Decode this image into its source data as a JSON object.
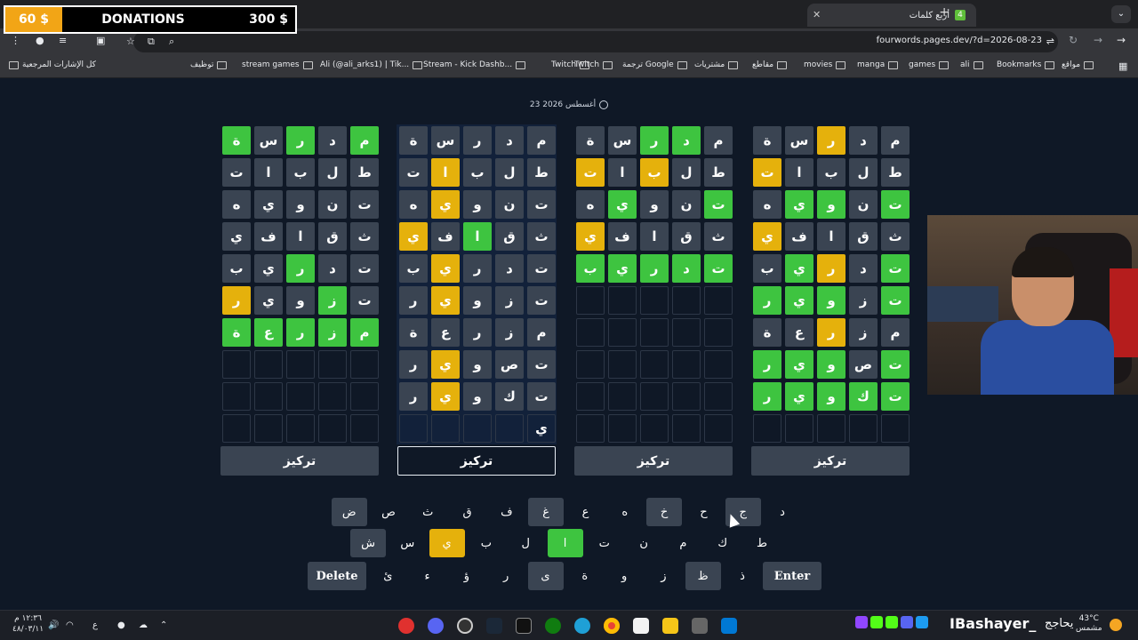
{
  "browser": {
    "tab_title": "أربع كلمات",
    "url": "fourwords.pages.dev/?d=2026-08-23",
    "bookmarks": [
      "مواقع",
      "Bookmarks",
      "ali",
      "games",
      "manga",
      "movies",
      "مقاطع",
      "مشتريات",
      "ترجمة Google",
      "Twitch",
      "Twitch",
      "Stream - Kick Dashb...",
      "Ali (@ali_arks1) | Tik...",
      "stream games",
      "توظيف"
    ],
    "bookmarks_right_label": "كل الإشارات المرجعية"
  },
  "donations": {
    "current": "60 $",
    "label": "DONATIONS",
    "goal": "300 $"
  },
  "date_label": "23 أغسطس 2026",
  "focus_label": "تركيز",
  "boards": [
    {
      "rows": [
        [
          [
            "م",
            "g"
          ],
          [
            "د",
            "n"
          ],
          [
            "ر",
            "g"
          ],
          [
            "س",
            "n"
          ],
          [
            "ة",
            "g"
          ]
        ],
        [
          [
            "ط",
            "n"
          ],
          [
            "ل",
            "n"
          ],
          [
            "ب",
            "n"
          ],
          [
            "ا",
            "n"
          ],
          [
            "ت",
            "n"
          ]
        ],
        [
          [
            "ت",
            "n"
          ],
          [
            "ن",
            "n"
          ],
          [
            "و",
            "n"
          ],
          [
            "ي",
            "n"
          ],
          [
            "ه",
            "n"
          ]
        ],
        [
          [
            "ث",
            "n"
          ],
          [
            "ق",
            "n"
          ],
          [
            "ا",
            "n"
          ],
          [
            "ف",
            "n"
          ],
          [
            "ي",
            "n"
          ]
        ],
        [
          [
            "ت",
            "n"
          ],
          [
            "د",
            "n"
          ],
          [
            "ر",
            "g"
          ],
          [
            "ي",
            "n"
          ],
          [
            "ب",
            "n"
          ]
        ],
        [
          [
            "ت",
            "n"
          ],
          [
            "ز",
            "g"
          ],
          [
            "و",
            "n"
          ],
          [
            "ي",
            "n"
          ],
          [
            "ر",
            "y"
          ]
        ],
        [
          [
            "م",
            "g"
          ],
          [
            "ز",
            "g"
          ],
          [
            "ر",
            "g"
          ],
          [
            "ع",
            "g"
          ],
          [
            "ة",
            "g"
          ]
        ],
        [
          [
            "",
            "e"
          ],
          [
            "",
            "e"
          ],
          [
            "",
            "e"
          ],
          [
            "",
            "e"
          ],
          [
            "",
            "e"
          ]
        ],
        [
          [
            "",
            "e"
          ],
          [
            "",
            "e"
          ],
          [
            "",
            "e"
          ],
          [
            "",
            "e"
          ],
          [
            "",
            "e"
          ]
        ],
        [
          [
            "",
            "e"
          ],
          [
            "",
            "e"
          ],
          [
            "",
            "e"
          ],
          [
            "",
            "e"
          ],
          [
            "",
            "e"
          ]
        ]
      ]
    },
    {
      "rows": [
        [
          [
            "م",
            "n"
          ],
          [
            "د",
            "n"
          ],
          [
            "ر",
            "n"
          ],
          [
            "س",
            "n"
          ],
          [
            "ة",
            "n"
          ]
        ],
        [
          [
            "ط",
            "n"
          ],
          [
            "ل",
            "n"
          ],
          [
            "ب",
            "n"
          ],
          [
            "ا",
            "y"
          ],
          [
            "ت",
            "n"
          ]
        ],
        [
          [
            "ت",
            "n"
          ],
          [
            "ن",
            "n"
          ],
          [
            "و",
            "n"
          ],
          [
            "ي",
            "y"
          ],
          [
            "ه",
            "n"
          ]
        ],
        [
          [
            "ث",
            "n"
          ],
          [
            "ق",
            "n"
          ],
          [
            "ا",
            "g"
          ],
          [
            "ف",
            "n"
          ],
          [
            "ي",
            "y"
          ]
        ],
        [
          [
            "ت",
            "n"
          ],
          [
            "د",
            "n"
          ],
          [
            "ر",
            "n"
          ],
          [
            "ي",
            "y"
          ],
          [
            "ب",
            "n"
          ]
        ],
        [
          [
            "ت",
            "n"
          ],
          [
            "ز",
            "n"
          ],
          [
            "و",
            "n"
          ],
          [
            "ي",
            "y"
          ],
          [
            "ر",
            "n"
          ]
        ],
        [
          [
            "م",
            "n"
          ],
          [
            "ز",
            "n"
          ],
          [
            "ر",
            "n"
          ],
          [
            "ع",
            "n"
          ],
          [
            "ة",
            "n"
          ]
        ],
        [
          [
            "ت",
            "n"
          ],
          [
            "ص",
            "n"
          ],
          [
            "و",
            "n"
          ],
          [
            "ي",
            "y"
          ],
          [
            "ر",
            "n"
          ]
        ],
        [
          [
            "ت",
            "n"
          ],
          [
            "ك",
            "n"
          ],
          [
            "و",
            "n"
          ],
          [
            "ي",
            "y"
          ],
          [
            "ر",
            "n"
          ]
        ],
        [
          [
            "ي",
            "e"
          ],
          [
            "",
            "e"
          ],
          [
            "",
            "e"
          ],
          [
            "",
            "e"
          ],
          [
            "",
            "e"
          ]
        ]
      ]
    },
    {
      "rows": [
        [
          [
            "م",
            "n"
          ],
          [
            "د",
            "g"
          ],
          [
            "ر",
            "g"
          ],
          [
            "س",
            "n"
          ],
          [
            "ة",
            "n"
          ]
        ],
        [
          [
            "ط",
            "n"
          ],
          [
            "ل",
            "n"
          ],
          [
            "ب",
            "y"
          ],
          [
            "ا",
            "n"
          ],
          [
            "ت",
            "y"
          ]
        ],
        [
          [
            "ت",
            "g"
          ],
          [
            "ن",
            "n"
          ],
          [
            "و",
            "n"
          ],
          [
            "ي",
            "g"
          ],
          [
            "ه",
            "n"
          ]
        ],
        [
          [
            "ث",
            "n"
          ],
          [
            "ق",
            "n"
          ],
          [
            "ا",
            "n"
          ],
          [
            "ف",
            "n"
          ],
          [
            "ي",
            "y"
          ]
        ],
        [
          [
            "ت",
            "g"
          ],
          [
            "د",
            "g"
          ],
          [
            "ر",
            "g"
          ],
          [
            "ي",
            "g"
          ],
          [
            "ب",
            "g"
          ]
        ],
        [
          [
            "",
            "e"
          ],
          [
            "",
            "e"
          ],
          [
            "",
            "e"
          ],
          [
            "",
            "e"
          ],
          [
            "",
            "e"
          ]
        ],
        [
          [
            "",
            "e"
          ],
          [
            "",
            "e"
          ],
          [
            "",
            "e"
          ],
          [
            "",
            "e"
          ],
          [
            "",
            "e"
          ]
        ],
        [
          [
            "",
            "e"
          ],
          [
            "",
            "e"
          ],
          [
            "",
            "e"
          ],
          [
            "",
            "e"
          ],
          [
            "",
            "e"
          ]
        ],
        [
          [
            "",
            "e"
          ],
          [
            "",
            "e"
          ],
          [
            "",
            "e"
          ],
          [
            "",
            "e"
          ],
          [
            "",
            "e"
          ]
        ],
        [
          [
            "",
            "e"
          ],
          [
            "",
            "e"
          ],
          [
            "",
            "e"
          ],
          [
            "",
            "e"
          ],
          [
            "",
            "e"
          ]
        ]
      ]
    },
    {
      "rows": [
        [
          [
            "م",
            "n"
          ],
          [
            "د",
            "n"
          ],
          [
            "ر",
            "y"
          ],
          [
            "س",
            "n"
          ],
          [
            "ة",
            "n"
          ]
        ],
        [
          [
            "ط",
            "n"
          ],
          [
            "ل",
            "n"
          ],
          [
            "ب",
            "n"
          ],
          [
            "ا",
            "n"
          ],
          [
            "ت",
            "y"
          ]
        ],
        [
          [
            "ت",
            "g"
          ],
          [
            "ن",
            "n"
          ],
          [
            "و",
            "g"
          ],
          [
            "ي",
            "g"
          ],
          [
            "ه",
            "n"
          ]
        ],
        [
          [
            "ث",
            "n"
          ],
          [
            "ق",
            "n"
          ],
          [
            "ا",
            "n"
          ],
          [
            "ف",
            "n"
          ],
          [
            "ي",
            "y"
          ]
        ],
        [
          [
            "ت",
            "g"
          ],
          [
            "د",
            "n"
          ],
          [
            "ر",
            "y"
          ],
          [
            "ي",
            "g"
          ],
          [
            "ب",
            "n"
          ]
        ],
        [
          [
            "ت",
            "g"
          ],
          [
            "ز",
            "n"
          ],
          [
            "و",
            "g"
          ],
          [
            "ي",
            "g"
          ],
          [
            "ر",
            "g"
          ]
        ],
        [
          [
            "م",
            "n"
          ],
          [
            "ز",
            "n"
          ],
          [
            "ر",
            "y"
          ],
          [
            "ع",
            "n"
          ],
          [
            "ة",
            "n"
          ]
        ],
        [
          [
            "ت",
            "g"
          ],
          [
            "ص",
            "n"
          ],
          [
            "و",
            "g"
          ],
          [
            "ي",
            "g"
          ],
          [
            "ر",
            "g"
          ]
        ],
        [
          [
            "ت",
            "g"
          ],
          [
            "ك",
            "g"
          ],
          [
            "و",
            "g"
          ],
          [
            "ي",
            "g"
          ],
          [
            "ر",
            "g"
          ]
        ],
        [
          [
            "",
            "e"
          ],
          [
            "",
            "e"
          ],
          [
            "",
            "e"
          ],
          [
            "",
            "e"
          ],
          [
            "",
            "e"
          ]
        ]
      ]
    }
  ],
  "keyboard": {
    "row1": [
      [
        "د",
        "plain"
      ],
      [
        "ج",
        "d"
      ],
      [
        "ح",
        "plain"
      ],
      [
        "خ",
        "d"
      ],
      [
        "ه",
        "plain"
      ],
      [
        "ع",
        "plain"
      ],
      [
        "غ",
        "d"
      ],
      [
        "ف",
        "plain"
      ],
      [
        "ق",
        "plain"
      ],
      [
        "ث",
        "plain"
      ],
      [
        "ص",
        "plain"
      ],
      [
        "ض",
        "d"
      ]
    ],
    "row2": [
      [
        "ط",
        "plain"
      ],
      [
        "ك",
        "plain"
      ],
      [
        "م",
        "plain"
      ],
      [
        "ن",
        "plain"
      ],
      [
        "ت",
        "plain"
      ],
      [
        "ا",
        "g"
      ],
      [
        "ل",
        "plain"
      ],
      [
        "ب",
        "plain"
      ],
      [
        "ي",
        "y"
      ],
      [
        "س",
        "plain"
      ],
      [
        "ش",
        "d"
      ]
    ],
    "row3": [
      [
        "ذ",
        "plain"
      ],
      [
        "ظ",
        "d"
      ],
      [
        "ز",
        "plain"
      ],
      [
        "و",
        "plain"
      ],
      [
        "ة",
        "plain"
      ],
      [
        "ى",
        "d"
      ],
      [
        "ر",
        "plain"
      ],
      [
        "ؤ",
        "plain"
      ],
      [
        "ء",
        "plain"
      ],
      [
        "ئ",
        "plain"
      ]
    ],
    "enter": "Enter",
    "delete": "Delete"
  },
  "taskbar": {
    "time": "١٢:٣٦ م",
    "date": "٤٨/٠٣/١١",
    "lang": "ع",
    "streamer": "IBashayer_",
    "streamer_verb": "يحاجج",
    "temperature": "43°C",
    "weather": "مشمس"
  },
  "colors": {
    "green": "#3ec440",
    "yellow": "#e5b10c",
    "gray": "#3a4452",
    "page_bg": "#0f1826"
  }
}
